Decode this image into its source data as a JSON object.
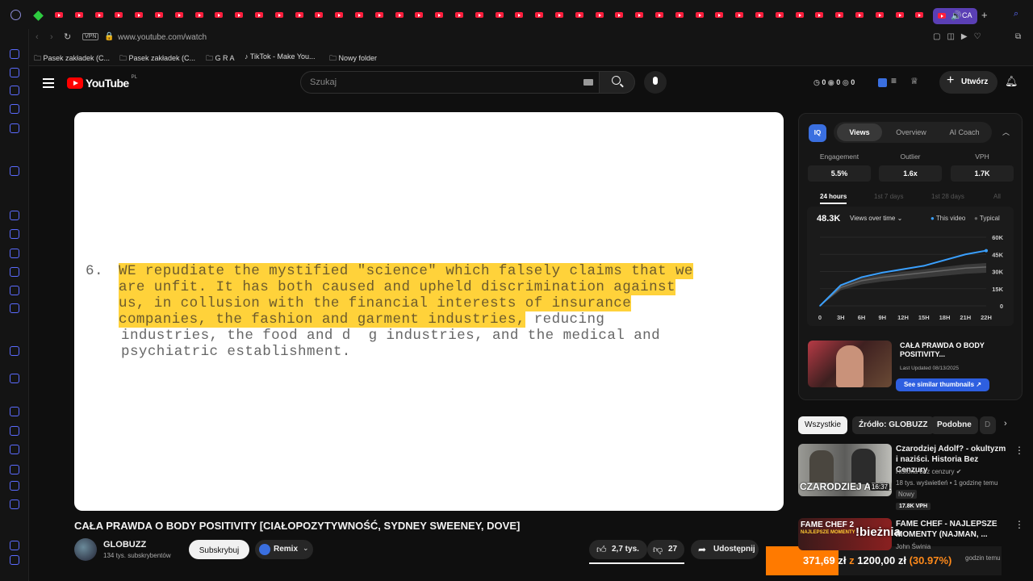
{
  "browser": {
    "url": "www.youtube.com/watch",
    "vpn_label": "VPN",
    "active_tab_label": "CA",
    "bookmarks": [
      "Pasek zakładek (C...",
      "Pasek zakładek (C...",
      "G R A",
      "TikTok - Make You...",
      "Nowy folder"
    ]
  },
  "header": {
    "logo_text": "YouTube",
    "region": "PL",
    "search_placeholder": "Szukaj",
    "counters": [
      "0",
      "0",
      "0"
    ],
    "create_label": "Utwórz"
  },
  "video": {
    "number": "6.",
    "lines_highlighted": [
      "WE repudiate the mystified \"science\" which falsely claims that we",
      "are unfit. It has both caused and upheld discrimination against",
      "us, in collusion with the financial interests of insurance",
      "companies, the fashion and garment industries,"
    ],
    "line4_rest": " reducing",
    "line5": "industries, the food and d  g industries, and the medical and",
    "line6": "psychiatric establishment."
  },
  "title": "CAŁA PRAWDA O BODY POSITIVITY [CIAŁOPOZYTYWNOŚĆ, SYDNEY SWEENEY, DOVE]",
  "channel": {
    "name": "GLOBUZZ",
    "subs": "134 tys. subskrybentów",
    "subscribe_label": "Subskrybuj",
    "remix_label": "Remix"
  },
  "actions": {
    "likes": "2,7 tys.",
    "dislikes": "27",
    "share": "Udostępnij"
  },
  "overlay": {
    "text": "371,69 zł",
    "z": "z",
    "goal": "1200,00 zł",
    "pct": "(30.97%)"
  },
  "iq": {
    "badge": "IQ",
    "tabs": [
      "Views",
      "Overview",
      "AI Coach"
    ],
    "stats": [
      {
        "label": "Engagement",
        "value": "5.5%"
      },
      {
        "label": "Outlier",
        "value": "1.6x"
      },
      {
        "label": "VPH",
        "value": "1.7K"
      }
    ],
    "ranges": [
      "24 hours",
      "1st 7 days",
      "1st 28 days",
      "All"
    ],
    "total": "48.3K",
    "dropdown": "Views over time",
    "legend_this": "This video",
    "legend_typical": "Typical",
    "y_ticks": [
      "60K",
      "45K",
      "30K",
      "15K",
      "0"
    ],
    "x_ticks": [
      "0",
      "3H",
      "6H",
      "9H",
      "12H",
      "15H",
      "18H",
      "21H",
      "22H"
    ],
    "thumb_title": "CAŁA PRAWDA O BODY POSITIVITY...",
    "thumb_updated": "Last Updated 08/13/2025",
    "similar_btn": "See similar thumbnails ↗"
  },
  "chart_data": {
    "type": "line",
    "x": [
      "0",
      "3H",
      "6H",
      "9H",
      "12H",
      "15H",
      "18H",
      "21H",
      "22H"
    ],
    "series": [
      {
        "name": "This video",
        "values": [
          0,
          18000,
          25000,
          29000,
          32000,
          35000,
          40000,
          45000,
          48300
        ]
      },
      {
        "name": "Typical",
        "values": [
          0,
          16000,
          22000,
          25000,
          27000,
          29000,
          31000,
          33000,
          34000
        ]
      }
    ],
    "ylim": [
      0,
      60000
    ]
  },
  "chips": [
    "Wszystkie",
    "Źródło: GLOBUZZ",
    "Podobne",
    "D"
  ],
  "recs": [
    {
      "title": "Czarodziej Adolf? - okultyzm i naziści. Historia Bez Cenzury",
      "channel": "Historia bez cenzury",
      "meta": "18 tys. wyświetleń • 1 godzinę temu",
      "badge": "Nowy",
      "vph": "17.8K VPH",
      "duration": "16:37",
      "thumb_text": "CZARODZIEJ ADOLF?"
    },
    {
      "title": "FAME CHEF - NAJLEPSZE MOMENTY (NAJMAN, ...",
      "channel": "John Świnia",
      "meta": "godzin temu",
      "thumb_text": "FAME CHEF 2",
      "thumb_sub": "NAJLEPSZE MOMENTY",
      "overlay_word": "!bieżnia"
    }
  ]
}
